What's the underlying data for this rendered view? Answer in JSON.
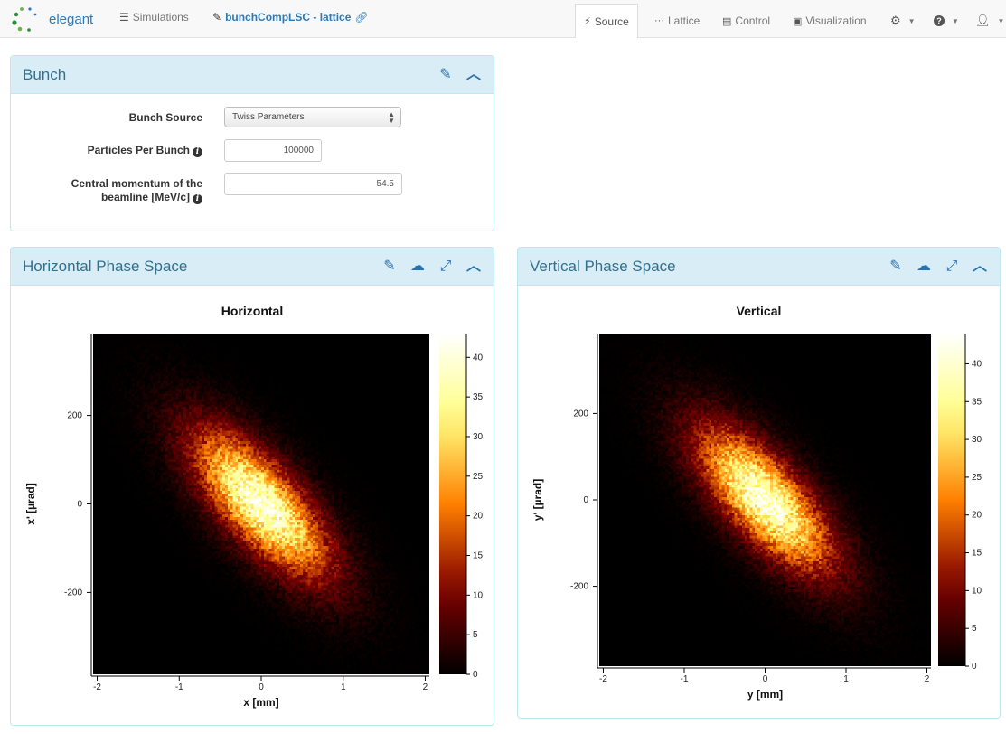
{
  "navbar": {
    "brand": "elegant",
    "simulations_label": "Simulations",
    "sim_title": "bunchCompLSC - lattice",
    "tabs": [
      {
        "label": "Source",
        "icon": "bolt-icon",
        "active": true
      },
      {
        "label": "Lattice",
        "icon": "ellipsis-icon",
        "active": false
      },
      {
        "label": "Control",
        "icon": "list-icon",
        "active": false
      },
      {
        "label": "Visualization",
        "icon": "picture-icon",
        "active": false
      }
    ]
  },
  "bunch_panel": {
    "title": "Bunch",
    "bunch_source_label": "Bunch Source",
    "bunch_source_value": "Twiss Parameters",
    "particles_label": "Particles Per Bunch",
    "particles_value": "100000",
    "momentum_label_line1": "Central momentum of the",
    "momentum_label_line2": "beamline [MeV/c]",
    "momentum_value": "54.5"
  },
  "horizontal_panel": {
    "title": "Horizontal Phase Space"
  },
  "vertical_panel": {
    "title": "Vertical Phase Space"
  },
  "colors": {
    "panel_heading": "#d9edf7",
    "panel_border": "#bce8f1",
    "panel_title": "#31708f",
    "link": "#2a7ab9"
  },
  "chart_data": [
    {
      "type": "heatmap",
      "title": "Horizontal",
      "xlabel": "x [mm]",
      "ylabel": "x' [µrad]",
      "xlim": [
        -2.05,
        2.05
      ],
      "ylim": [
        -385,
        385
      ],
      "x_ticks": [
        -2,
        -1,
        0,
        1,
        2
      ],
      "y_ticks": [
        -200,
        0,
        200
      ],
      "colorbar_ticks": [
        0,
        5,
        10,
        15,
        20,
        25,
        30,
        35,
        40
      ],
      "colorbar_max": 43,
      "colormap": "afmhot",
      "distribution": {
        "center_x": 0,
        "center_y": 0,
        "sigma_x": 0.55,
        "sigma_y": 110,
        "correlation": -0.72,
        "peak": 43
      }
    },
    {
      "type": "heatmap",
      "title": "Vertical",
      "xlabel": "y [mm]",
      "ylabel": "y' [µrad]",
      "xlim": [
        -2.05,
        2.05
      ],
      "ylim": [
        -385,
        385
      ],
      "x_ticks": [
        -2,
        -1,
        0,
        1,
        2
      ],
      "y_ticks": [
        -200,
        0,
        200
      ],
      "colorbar_ticks": [
        0,
        5,
        10,
        15,
        20,
        25,
        30,
        35,
        40
      ],
      "colorbar_max": 44,
      "colormap": "afmhot",
      "distribution": {
        "center_x": 0,
        "center_y": 0,
        "sigma_x": 0.55,
        "sigma_y": 110,
        "correlation": -0.72,
        "peak": 44
      }
    }
  ]
}
